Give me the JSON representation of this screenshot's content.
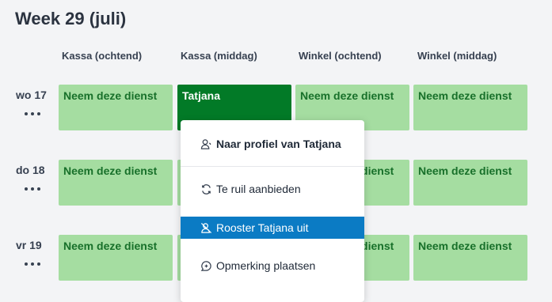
{
  "week_title": "Week 29 (juli)",
  "columns": [
    "Kassa (ochtend)",
    "Kassa (middag)",
    "Winkel (ochtend)",
    "Winkel (middag)"
  ],
  "days": [
    {
      "label": "wo 17",
      "cells": [
        "Neem deze dienst",
        "Tatjana",
        "Neem deze dienst",
        "Neem deze dienst"
      ]
    },
    {
      "label": "do 18",
      "cells": [
        "Neem deze dienst",
        "",
        "Neem deze dienst",
        "Neem deze dienst"
      ]
    },
    {
      "label": "vr 19",
      "cells": [
        "Neem deze dienst",
        "",
        "Neem deze dienst",
        "Neem deze dienst"
      ]
    }
  ],
  "context_menu": {
    "profile": "Naar profiel van Tatjana",
    "trade": "Te ruil aanbieden",
    "unschedule": "Rooster Tatjana uit",
    "comment": "Opmerking plaatsen"
  },
  "colors": {
    "open_shift": "#a5dda1",
    "taken_shift": "#027a27",
    "menu_highlight": "#0b7bc4"
  }
}
